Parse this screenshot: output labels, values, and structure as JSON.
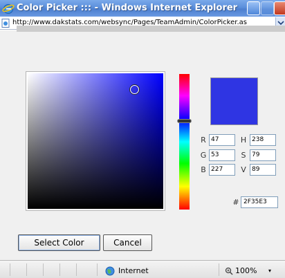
{
  "window": {
    "title": "Color Picker ::: - Windows Internet Explorer",
    "address": "http://www.dakstats.com/websync/Pages/TeamAdmin/ColorPicker.as"
  },
  "picker": {
    "fields": {
      "r_label": "R",
      "r_value": "47",
      "g_label": "G",
      "g_value": "53",
      "b_label": "B",
      "b_value": "227",
      "h_label": "H",
      "h_value": "238",
      "s_label": "S",
      "s_value": "79",
      "v_label": "V",
      "v_value": "89"
    },
    "hex_label": "#",
    "hex_value": "2F35E3",
    "preview_color": "#2F35E3",
    "hue_base_color": "#0000FF"
  },
  "buttons": {
    "select_label": "Select Color",
    "cancel_label": "Cancel"
  },
  "status": {
    "zone": "Internet",
    "zoom": "100%",
    "zoom_arrow": "▾"
  },
  "icons": {
    "app": "internet-explorer-icon",
    "page": "page-icon",
    "globe": "globe-icon",
    "zoom": "zoom-icon"
  }
}
